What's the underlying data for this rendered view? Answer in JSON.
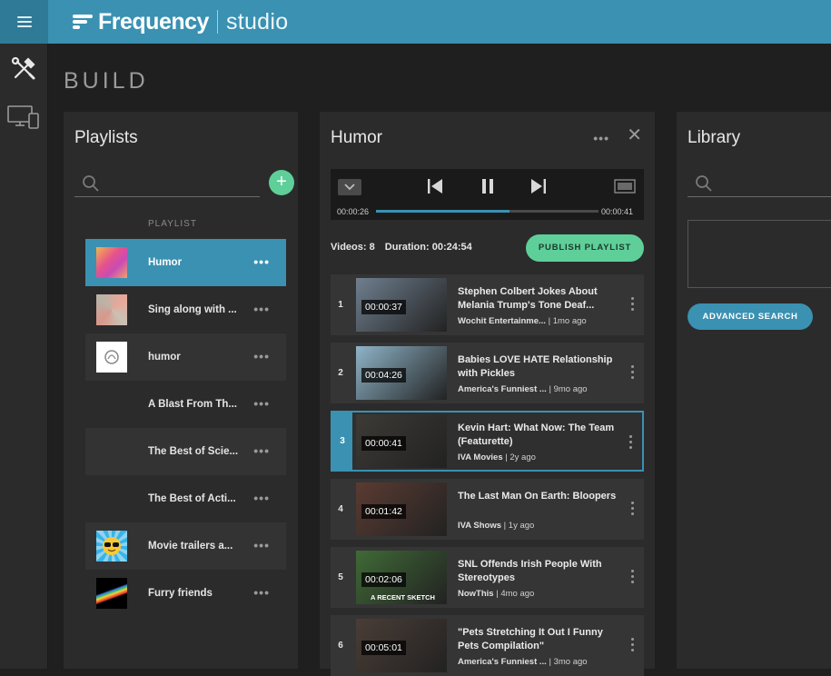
{
  "app": {
    "brand": "Frequency",
    "product": "studio"
  },
  "page": {
    "title": "BUILD"
  },
  "colors": {
    "accent": "#3a91b2",
    "green": "#5fcf9a",
    "panel": "#2b2b2b",
    "background": "#1f1f1f"
  },
  "rail": {
    "icons": [
      "tools-icon",
      "devices-icon"
    ]
  },
  "playlists": {
    "title": "Playlists",
    "search_placeholder": "",
    "add_label": "+",
    "column_header": "PLAYLIST",
    "items": [
      {
        "label": "Humor",
        "active": true,
        "thumb": "mosaic"
      },
      {
        "label": "Sing along with ...",
        "active": false,
        "thumb": "triangles"
      },
      {
        "label": "humor",
        "active": false,
        "thumb": "logo"
      },
      {
        "label": "A Blast From Th...",
        "active": false,
        "thumb": "none"
      },
      {
        "label": "The Best of Scie...",
        "active": false,
        "thumb": "none"
      },
      {
        "label": "The Best of Acti...",
        "active": false,
        "thumb": "none"
      },
      {
        "label": "Movie trailers a...",
        "active": false,
        "thumb": "sunglasses"
      },
      {
        "label": "Furry friends",
        "active": false,
        "thumb": "rainbow"
      }
    ],
    "more_label": "•••"
  },
  "humor": {
    "title": "Humor",
    "more_label": "•••",
    "close_label": "✕",
    "player": {
      "current_time": "00:00:26",
      "total_time": "00:00:41",
      "progress": 0.6
    },
    "videos_count_label": "Videos: 8",
    "duration_label": "Duration: 00:24:54",
    "publish_label": "PUBLISH PLAYLIST",
    "videos": [
      {
        "num": "1",
        "duration": "00:00:37",
        "title": "Stephen Colbert Jokes About Melania Trump's Tone Deaf...",
        "source": "Wochit Entertainme...",
        "age": "1mo ago",
        "thumb_color": "#6f7f8f"
      },
      {
        "num": "2",
        "duration": "00:04:26",
        "title": "Babies LOVE HATE Relationship with Pickles",
        "source": "America's Funniest ...",
        "age": "9mo ago",
        "thumb_color": "#8fb4c8"
      },
      {
        "num": "3",
        "duration": "00:00:41",
        "title": "Kevin Hart: What Now: The Team (Featurette)",
        "source": "IVA Movies",
        "age": "2y ago",
        "thumb_color": "#3d3a36",
        "selected": true
      },
      {
        "num": "4",
        "duration": "00:01:42",
        "title": "The Last Man On Earth: Bloopers",
        "source": "IVA Shows",
        "age": "1y ago",
        "thumb_color": "#5a3b32"
      },
      {
        "num": "5",
        "duration": "00:02:06",
        "title": "SNL Offends Irish People With Stereotypes",
        "source": "NowThis",
        "age": "4mo ago",
        "thumb_color": "#3f6a36",
        "caption": "A RECENT SKETCH"
      },
      {
        "num": "6",
        "duration": "00:05:01",
        "title": "\"Pets Stretching It Out I Funny Pets Compilation\"",
        "source": "America's Funniest ...",
        "age": "3mo ago",
        "thumb_color": "#4a3d36"
      }
    ]
  },
  "library": {
    "title": "Library",
    "search_placeholder": "",
    "advanced_search_label": "ADVANCED SEARCH"
  }
}
